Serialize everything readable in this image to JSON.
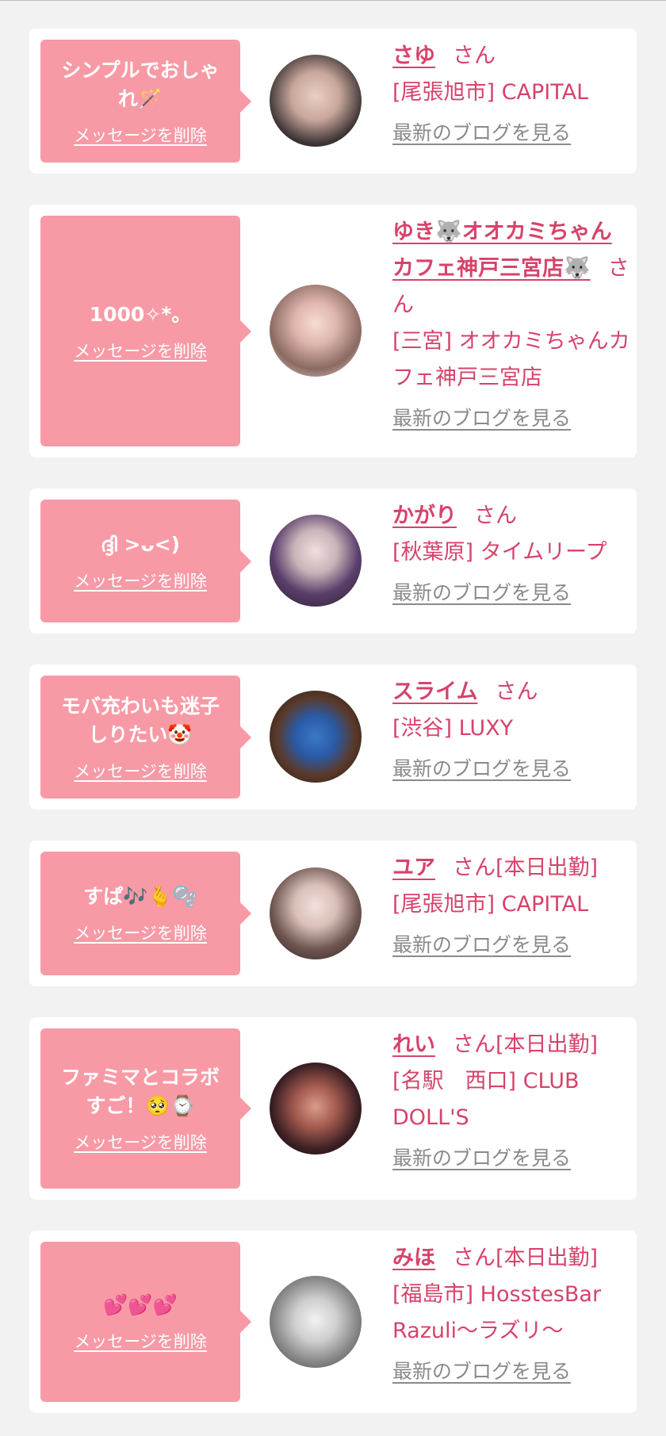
{
  "delete_label": "メッセージを削除",
  "blog_label": "最新のブログを見る",
  "suffix": "さん",
  "cards": [
    {
      "message": "シンプルでおしゃれ🪄",
      "name": "さゆ",
      "status": "",
      "location": "[尾張旭市] CAPITAL",
      "avatar_icon": "profile-photo"
    },
    {
      "message": "1000✧*。",
      "name": "ゆき🐺オオカミちゃんカフェ神戸三宮店🐺",
      "status": "",
      "location": "[三宮] オオカミちゃんカフェ神戸三宮店",
      "avatar_icon": "profile-photo"
    },
    {
      "message": "ദ്ദി >ᴗ<)",
      "name": "かがり",
      "status": "",
      "location": "[秋葉原] タイムリープ",
      "avatar_icon": "profile-photo"
    },
    {
      "message": "モバ充わいも迷子しりたい🤡",
      "name": "スライム",
      "status": "",
      "location": "[渋谷] LUXY",
      "avatar_icon": "slime-photo"
    },
    {
      "message": "すぱ🎶🫰🫧",
      "name": "ユア",
      "status": "[本日出勤]",
      "location": "[尾張旭市] CAPITAL",
      "avatar_icon": "profile-photo"
    },
    {
      "message": "ファミマとコラボすご！🥺⌚",
      "name": "れい",
      "status": "[本日出勤]",
      "location": "[名駅　西口] CLUB DOLL'S",
      "avatar_icon": "profile-photo"
    },
    {
      "message": "💕💕💕",
      "name": "みほ",
      "status": "[本日出勤]",
      "location": "[福島市] HosstesBar Razuli～ラズリ～",
      "avatar_icon": "monochrome-photo"
    }
  ],
  "colors": {
    "background": "#f2f2f2",
    "bubble": "#f79aa6",
    "name": "#d6436a",
    "link": "#8a8a8a"
  }
}
